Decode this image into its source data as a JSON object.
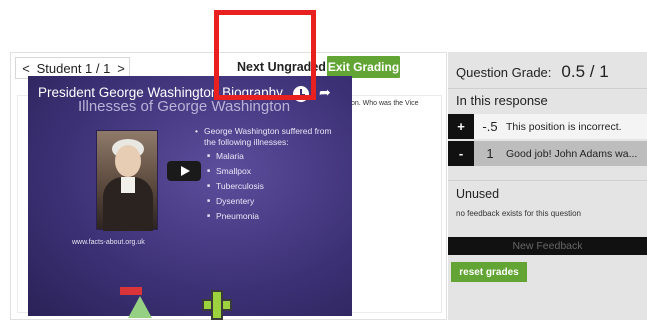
{
  "toolbar": {
    "prev_arrow": "<",
    "student_label": "Student 1 / 1",
    "next_arrow": ">",
    "next_ungraded": "Next Ungraded",
    "exit_grading": "Exit Grading"
  },
  "question": {
    "text": "Watch the video about George Washington. Mark in green the part of the video that answers this question. Who was the Vice President when George Washington was President?"
  },
  "video": {
    "title": "President George Washington Biography",
    "subtitle": "Illnesses of George Washington",
    "lead_bullet": "George Washington suffered from the following illnesses:",
    "illnesses": [
      "Malaria",
      "Smallpox",
      "Tuberculosis",
      "Dysentery",
      "Pneumonia"
    ],
    "url": "www.facts-about.org.uk",
    "icons": [
      "clock-icon",
      "share-icon",
      "play-icon",
      "add-marker-icon"
    ]
  },
  "grading": {
    "question_grade_label": "Question Grade:",
    "question_grade_value": "0.5 / 1",
    "in_response_label": "In this response",
    "feedback": [
      {
        "toggle": "+",
        "score": "-.5",
        "text": "This position is incorrect."
      },
      {
        "toggle": "-",
        "score": "1",
        "text": "Good job! John Adams wa..."
      }
    ],
    "unused_label": "Unused",
    "no_feedback_text": "no feedback exists for this question",
    "new_feedback_label": "New Feedback",
    "reset_grades_label": "reset grades"
  },
  "colors": {
    "accent_green": "#63a535",
    "highlight_red": "#e8201f",
    "panel_gray": "#e4e4e4"
  }
}
